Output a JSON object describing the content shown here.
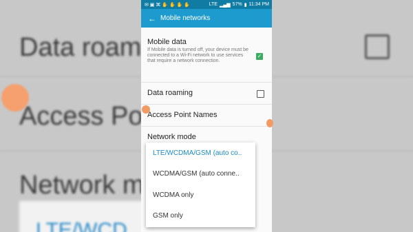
{
  "status_bar": {
    "network": "LTE",
    "battery": "57%",
    "time": "11:34 PM"
  },
  "app_bar": {
    "title": "Mobile networks"
  },
  "settings": {
    "mobile_data": {
      "label": "Mobile data",
      "description": "If Mobile data is turned off, your device must be connected to a Wi-Fi network to use services that require a network connection.",
      "checked": true
    },
    "data_roaming": {
      "label": "Data roaming",
      "checked": false
    },
    "access_point_names": {
      "label": "Access Point Names"
    },
    "network_mode": {
      "label": "Network mode"
    }
  },
  "network_mode_options": [
    {
      "label": "LTE/WCDMA/GSM (auto co..",
      "selected": true
    },
    {
      "label": "WCDMA/GSM (auto conne..",
      "selected": false
    },
    {
      "label": "WCDMA only",
      "selected": false
    },
    {
      "label": "GSM only",
      "selected": false
    }
  ],
  "background": {
    "data_roaming": "Data roami",
    "access_point": "Access Poi",
    "network_mode": "Network m",
    "option": "LTE/WCD"
  },
  "colors": {
    "status_bar": "#107ba3",
    "app_bar": "#1e9bce",
    "accent": "#1a8bc0",
    "checkbox_on": "#3dab63"
  }
}
